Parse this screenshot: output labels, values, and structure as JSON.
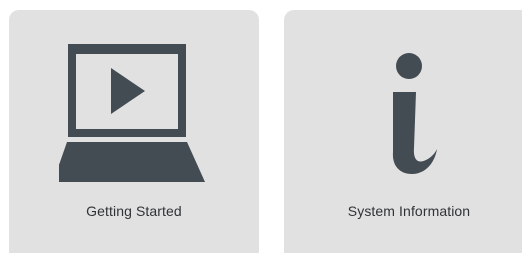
{
  "tiles": [
    {
      "label": "Getting Started",
      "icon": "laptop-play-icon"
    },
    {
      "label": "System Information",
      "icon": "info-icon"
    }
  ],
  "colors": {
    "tile_background": "#e1e1e1",
    "icon": "#434b53",
    "text": "#2f3336"
  }
}
